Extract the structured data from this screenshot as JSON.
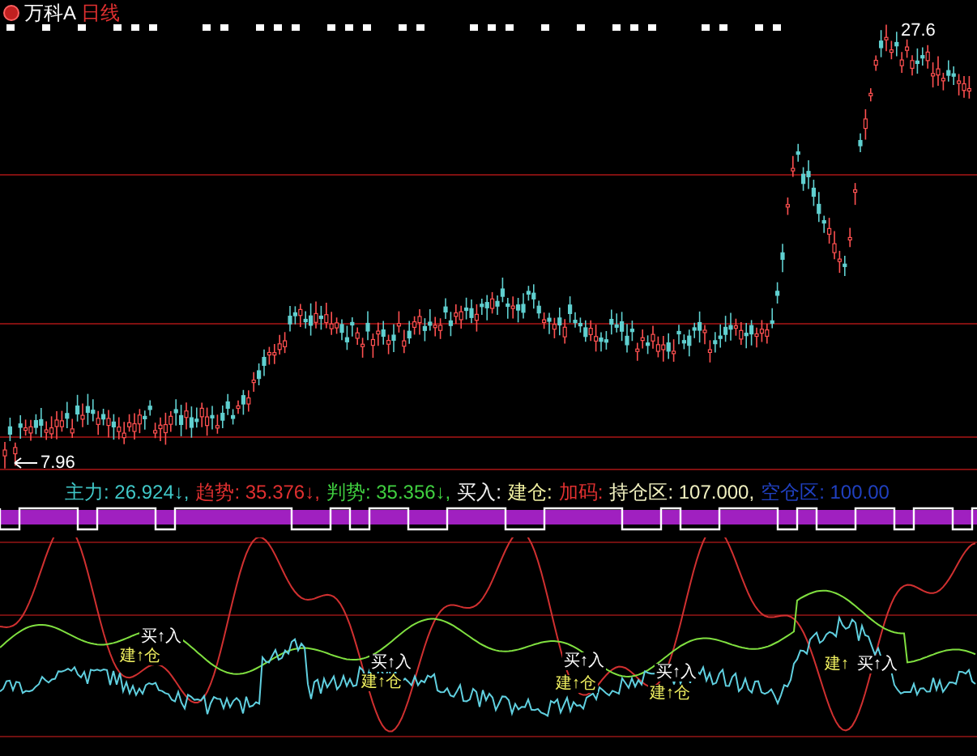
{
  "window": {
    "title": "万科A",
    "period": "日线"
  },
  "price_chart": {
    "low_label": "7.96",
    "high_label": "27.6"
  },
  "indicator": {
    "items": [
      {
        "text": "主力: 26.924↓,",
        "color": "#40c8c8"
      },
      {
        "text": "趋势: 35.376↓,",
        "color": "#e03030"
      },
      {
        "text": "判势: 35.356↓,",
        "color": "#40d040"
      },
      {
        "text": "买入:",
        "color": "#f0f0f0"
      },
      {
        "text": "建仓:",
        "color": "#f0f0a0"
      },
      {
        "text": "加码:",
        "color": "#e03030"
      },
      {
        "text": "持仓区: 107.000,",
        "color": "#f0f0c0"
      },
      {
        "text": "空仓区: 100.00",
        "color": "#2040c0"
      }
    ]
  },
  "signals": [
    {
      "kind": "buy",
      "text": "买↑入"
    },
    {
      "kind": "build",
      "text": "建↑仓"
    },
    {
      "kind": "buy",
      "text": "买↑入"
    },
    {
      "kind": "build",
      "text": "建↑仓"
    },
    {
      "kind": "buy",
      "text": "买↑入"
    },
    {
      "kind": "build",
      "text": "建↑仓"
    },
    {
      "kind": "buy",
      "text": "买↑入"
    },
    {
      "kind": "build",
      "text": "建↑仓"
    },
    {
      "kind": "build",
      "text": "建↑"
    },
    {
      "kind": "buy",
      "text": "买↑入"
    }
  ]
}
